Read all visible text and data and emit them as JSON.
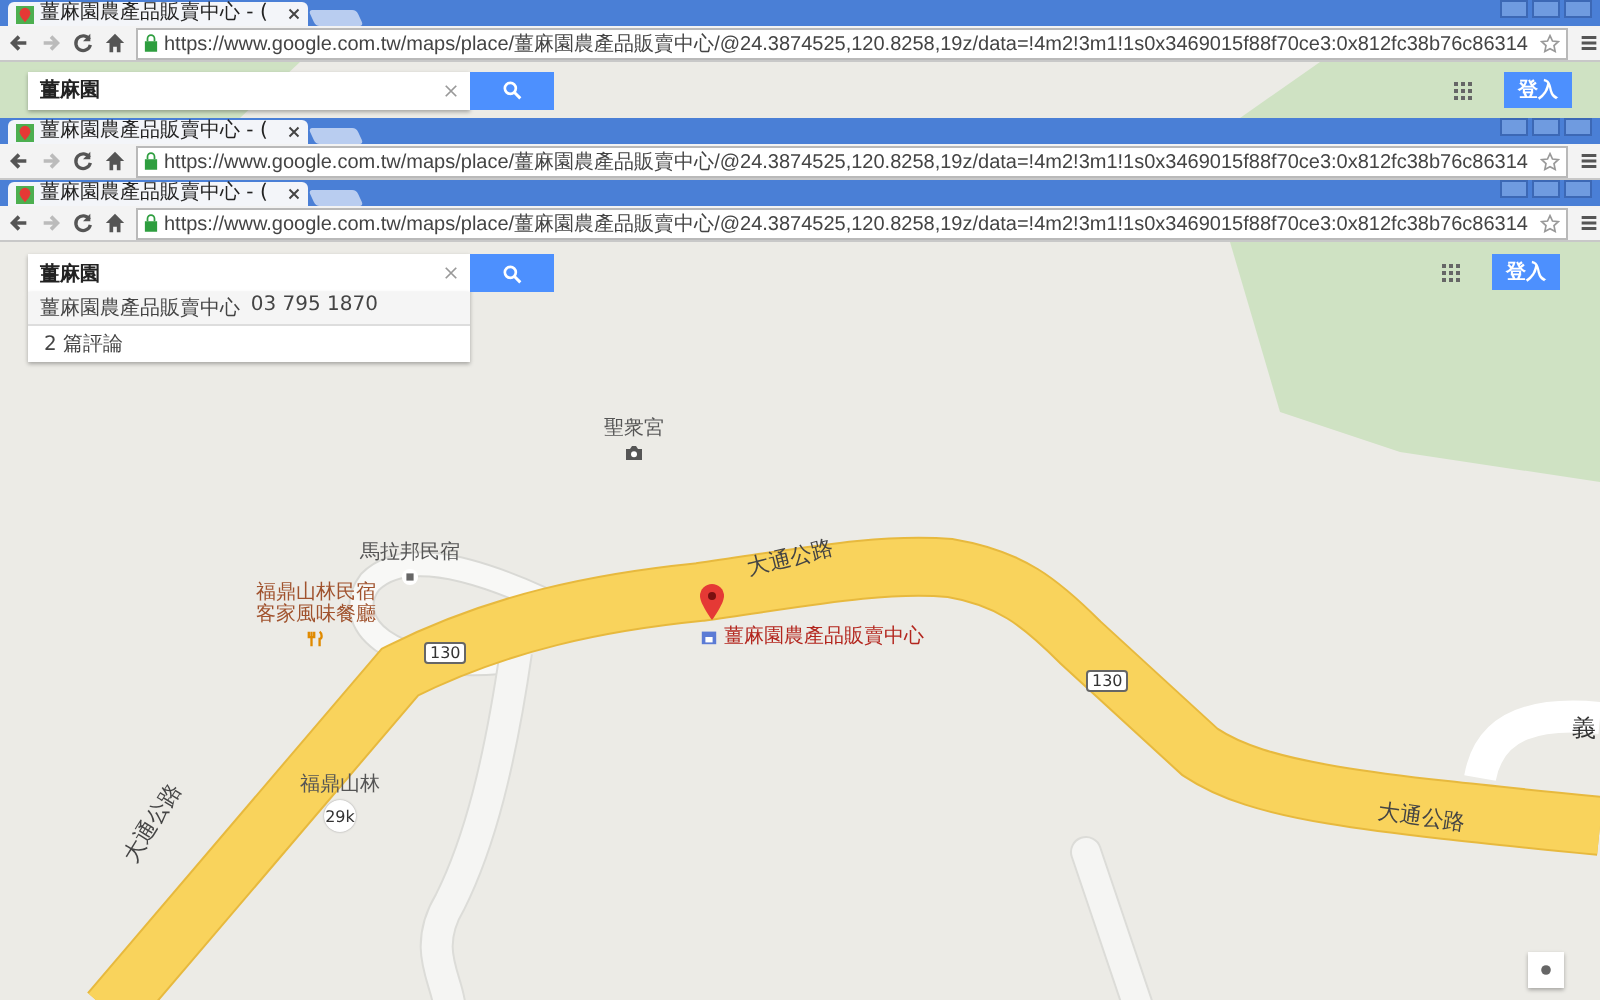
{
  "windows": [
    {
      "tab_title": "薑麻園農產品販賣中心 - (",
      "url": "https://www.google.com.tw/maps/place/薑麻園農產品販賣中心/@24.3874525,120.8258,19z/data=!4m2!3m1!1s0x3469015f88f70ce3:0x812fc38b76c86314"
    },
    {
      "tab_title": "薑麻園農產品販賣中心 - (",
      "url": "https://www.google.com.tw/maps/place/薑麻園農產品販賣中心/@24.3874525,120.8258,19z/data=!4m2!3m1!1s0x3469015f88f70ce3:0x812fc38b76c86314"
    },
    {
      "tab_title": "薑麻園農產品販賣中心 - (",
      "url": "https://www.google.com.tw/maps/place/薑麻園農產品販賣中心/@24.3874525,120.8258,19z/data=!4m2!3m1!1s0x3469015f88f70ce3:0x812fc38b76c86314"
    }
  ],
  "top_strip": {
    "search_value": "薑麻園",
    "sign_in": "登入"
  },
  "map": {
    "search_value": "薑麻園",
    "sign_in": "登入",
    "suggestion": {
      "name": "薑麻園農產品販賣中心",
      "phone": "03 795 1870",
      "reviews": "2 篇評論"
    },
    "places": [
      {
        "kind": "camera",
        "label": "聖衆宮"
      },
      {
        "kind": "dot",
        "label": "馬拉邦民宿"
      },
      {
        "kind": "fork",
        "label": "福鼎山林民宿客家風味餐廳"
      },
      {
        "kind": "badge",
        "label": "福鼎山林",
        "badge": "29k"
      },
      {
        "kind": "cut",
        "label": "義"
      }
    ],
    "roads": [
      "大通公路",
      "大通公路",
      "大通公路"
    ],
    "shields": [
      "130",
      "130"
    ],
    "marker_label": "薑麻園農產品販賣中心"
  }
}
